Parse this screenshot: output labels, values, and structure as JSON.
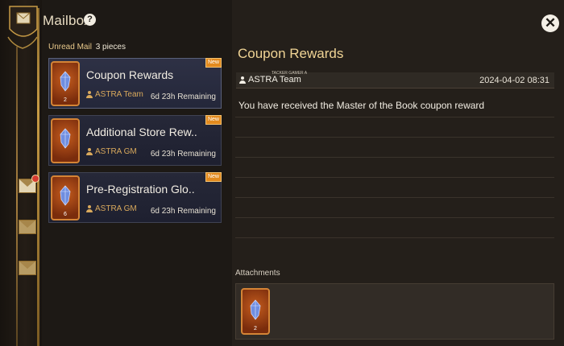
{
  "header": {
    "title": "Mailbox",
    "help_glyph": "?",
    "close_glyph": "✕"
  },
  "list": {
    "unread_label": "Unread Mail",
    "unread_count": "3 pieces",
    "items": [
      {
        "subject": "Coupon Rewards",
        "sender": "ASTRA Team",
        "remaining": "6d 23h Remaining",
        "badge": "New",
        "item_count": "2",
        "selected": true
      },
      {
        "subject": "Additional Store Rew..",
        "sender": "ASTRA GM",
        "remaining": "6d 23h Remaining",
        "badge": "New",
        "item_count": "",
        "selected": false
      },
      {
        "subject": "Pre-Registration Glo..",
        "sender": "ASTRA GM",
        "remaining": "6d 23h Remaining",
        "badge": "New",
        "item_count": "6",
        "selected": false
      }
    ]
  },
  "detail": {
    "title": "Coupon Rewards",
    "sender": "ASTRA Team",
    "watermark": "TACKER GAMER A",
    "datetime": "2024-04-02  08:31",
    "body": "You have received the Master of the Book coupon reward",
    "attachments_label": "Attachments",
    "attachment_count": "2"
  },
  "icons": {
    "rail": [
      "mail-tab-icon",
      "mail-unread-icon",
      "mail-system-icon",
      "mail-archive-icon"
    ],
    "item": "blue-crystal-icon"
  },
  "colors": {
    "accent_gold": "#f0d495",
    "new_badge": "#e28a1e",
    "sender_gold": "#d9a95c",
    "card_bg": "#262838"
  }
}
